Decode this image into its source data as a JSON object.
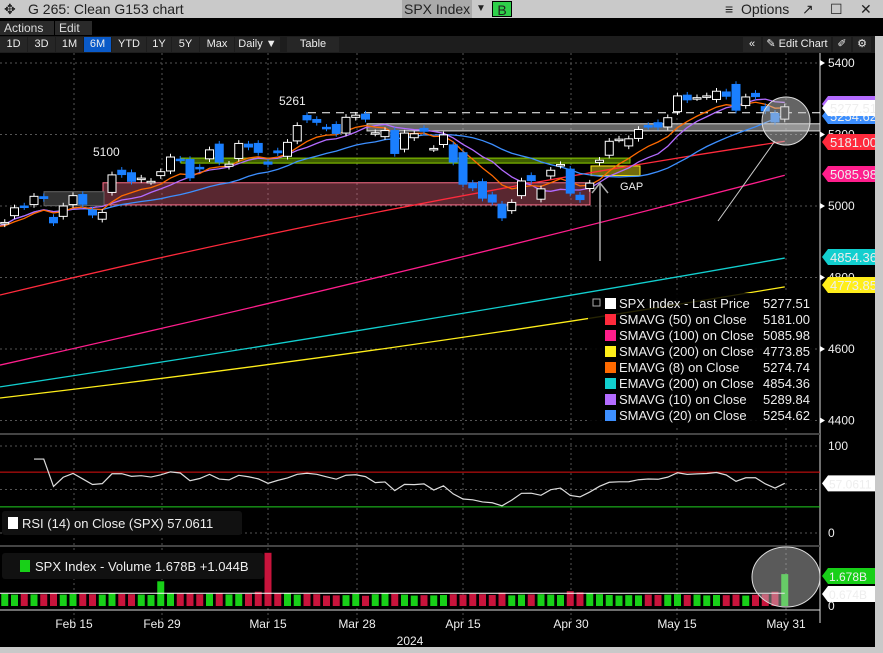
{
  "window": {
    "title": "G 265: Clean G153 chart",
    "security": "SPX Index",
    "b_badge": "B",
    "options": "Options",
    "icons": [
      "crosshair-move-icon",
      "dropdown-icon",
      "menu-icon",
      "popout-icon",
      "maximize-icon",
      "close-icon"
    ]
  },
  "menu": {
    "actions": "Actions",
    "edit": "Edit"
  },
  "toolbar": {
    "ranges": [
      "1D",
      "3D",
      "1M",
      "6M",
      "YTD",
      "1Y",
      "5Y",
      "Max"
    ],
    "selected": "6M",
    "frequency": "Daily",
    "table": "Table",
    "edit_chart": "Edit Chart"
  },
  "price_axis": {
    "ticks": [
      "5400",
      "5200",
      "5000",
      "4800",
      "4600",
      "4400"
    ]
  },
  "tags": [
    {
      "label": "5289.84",
      "color": "#b36bff"
    },
    {
      "label": "5254.62",
      "color": "#3d8fff"
    },
    {
      "label": "5277.51",
      "color": "#ffffff"
    },
    {
      "label": "5181.00",
      "color": "#ff2a3c"
    },
    {
      "label": "5085.98",
      "color": "#ff1e8c"
    },
    {
      "label": "4854.36",
      "color": "#12cfcf"
    },
    {
      "label": "4773.85",
      "color": "#ffee1a"
    }
  ],
  "annotations": {
    "label_5261": "5261",
    "label_5100": "5100",
    "gap": "GAP"
  },
  "legend": [
    {
      "name": "SPX Index - Last Price",
      "value": "5277.51",
      "color": "#ffffff"
    },
    {
      "name": "SMAVG (50)  on Close",
      "value": "5181.00",
      "color": "#ff2a3c"
    },
    {
      "name": "SMAVG (100)  on Close",
      "value": "5085.98",
      "color": "#ff1e8c"
    },
    {
      "name": "SMAVG (200)  on Close",
      "value": "4773.85",
      "color": "#ffee1a"
    },
    {
      "name": "EMAVG (8)  on Close",
      "value": "5274.74",
      "color": "#ff6a00"
    },
    {
      "name": "EMAVG (200)  on Close",
      "value": "4854.36",
      "color": "#12cfcf"
    },
    {
      "name": "SMAVG (10)  on Close",
      "value": "5289.84",
      "color": "#b36bff"
    },
    {
      "name": "SMAVG (20)  on Close",
      "value": "5254.62",
      "color": "#3d8fff"
    }
  ],
  "rsi": {
    "legend": "RSI (14)  on Close (SPX) 57.0611",
    "value": "57.0611",
    "ticks": [
      "100",
      "0"
    ],
    "upper": 70,
    "lower": 30
  },
  "volume": {
    "legend": "SPX Index - Volume 1.678B  +1.044B",
    "last": "1.678B",
    "avg": "0.674B",
    "zero": "0"
  },
  "x_axis": {
    "labels": [
      "Feb 15",
      "Feb 29",
      "Mar 15",
      "Mar 28",
      "Apr 15",
      "Apr 30",
      "May 15",
      "May 31"
    ],
    "year": "2024"
  },
  "chart_data": {
    "type": "candlestick",
    "ylim": [
      4360,
      5440
    ],
    "close": [
      4942,
      4954,
      4995,
      4998,
      5027,
      5021,
      4953,
      5000,
      5029,
      5005,
      4975,
      4982,
      5087,
      5088,
      5069,
      5078,
      5069,
      5096,
      5137,
      5130,
      5079,
      5104,
      5157,
      5123,
      5117,
      5175,
      5165,
      5150,
      5117,
      5149,
      5178,
      5225,
      5241,
      5234,
      5218,
      5203,
      5248,
      5254,
      5243,
      5205,
      5211,
      5147,
      5204,
      5202,
      5209,
      5161,
      5199,
      5123,
      5061,
      5051,
      5022,
      5011,
      4967,
      5010,
      5070,
      5071,
      5048,
      5100,
      5116,
      5036,
      5018,
      5064,
      5128,
      5181,
      5187,
      5188,
      5214,
      5223,
      5221,
      5247,
      5308,
      5297,
      5303,
      5308,
      5321,
      5307,
      5268,
      5305,
      5306,
      5266,
      5235,
      5277.51
    ],
    "open": [
      4957,
      4950,
      4973,
      5000,
      5004,
      5026,
      4968,
      4971,
      5004,
      5032,
      4989,
      4963,
      5038,
      5100,
      5093,
      5074,
      5068,
      5085,
      5098,
      5131,
      5130,
      5108,
      5132,
      5173,
      5111,
      5133,
      5173,
      5175,
      5123,
      5154,
      5139,
      5182,
      5253,
      5242,
      5220,
      5228,
      5204,
      5248,
      5257,
      5204,
      5194,
      5211,
      5159,
      5191,
      5217,
      5160,
      5172,
      5171,
      5149,
      5064,
      5068,
      5031,
      5005,
      4987,
      5029,
      5085,
      5019,
      5084,
      5114,
      5103,
      5030,
      5049,
      5122,
      5142,
      5187,
      5168,
      5189,
      5225,
      5233,
      5221,
      5264,
      5310,
      5303,
      5306,
      5298,
      5319,
      5340,
      5281,
      5315,
      5278,
      5259,
      5243
    ],
    "volume_billions": [
      0.62,
      0.64,
      0.6,
      0.63,
      0.61,
      0.62,
      0.66,
      0.6,
      0.63,
      0.64,
      0.62,
      0.6,
      0.66,
      0.63,
      0.62,
      0.6,
      0.58,
      1.3,
      0.66,
      0.65,
      0.66,
      0.62,
      0.64,
      0.67,
      0.61,
      0.63,
      0.64,
      0.75,
      2.8,
      0.68,
      0.66,
      0.6,
      0.64,
      0.62,
      0.55,
      0.56,
      0.57,
      0.64,
      0.54,
      0.62,
      0.66,
      0.64,
      0.6,
      0.55,
      0.57,
      0.56,
      0.58,
      0.62,
      0.6,
      0.64,
      0.62,
      0.58,
      0.7,
      0.56,
      0.6,
      0.61,
      0.62,
      0.6,
      0.58,
      0.78,
      0.72,
      0.66,
      0.62,
      0.58,
      0.55,
      0.57,
      0.56,
      0.6,
      0.58,
      0.6,
      0.62,
      0.58,
      0.6,
      0.56,
      0.58,
      0.57,
      0.6,
      0.55,
      0.59,
      0.62,
      0.75,
      1.678
    ],
    "volume_avg": 0.674,
    "ma_long": {
      "SMAVG (50)": [
        4751,
        4960,
        5181
      ],
      "SMAVG (100)": [
        4555,
        4800,
        5085.98
      ],
      "SMAVG (200)": [
        4463,
        4590,
        4773.85
      ],
      "EMAVG (200)": [
        4494,
        4660,
        4854.36
      ]
    },
    "zones": [
      {
        "from": 5003,
        "to": 5065,
        "color": "#ff6f8a",
        "start": "Feb 22",
        "end": "Apr 30"
      },
      {
        "from": 5120,
        "to": 5134,
        "color": "#8ccf00",
        "start": "Mar 1",
        "end": "May 3"
      },
      {
        "from": 5210,
        "to": 5230,
        "color": "#e0e0e0",
        "start": "Mar 22",
        "end": "May 31"
      },
      {
        "from": 5085,
        "to": 5112,
        "color": "#ffee1a",
        "start": "May 1",
        "end": "May 6"
      }
    ],
    "resistance": 5261
  }
}
